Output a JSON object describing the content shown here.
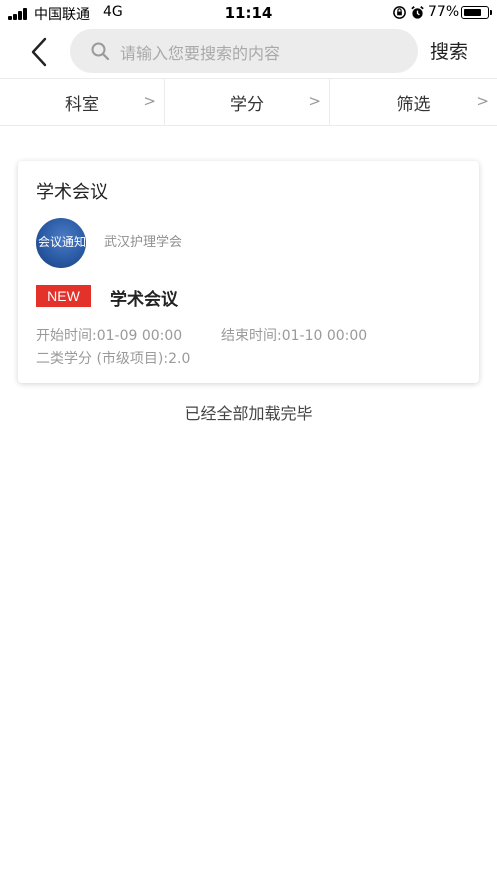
{
  "status_bar": {
    "carrier": "中国联通",
    "network": "4G",
    "time": "11:14",
    "battery_percent": "77%",
    "battery_level": 0.77
  },
  "header": {
    "search_placeholder": "请输入您要搜索的内容",
    "search_button": "搜索"
  },
  "filters": [
    {
      "label": "科室",
      "arrow": ">"
    },
    {
      "label": "学分",
      "arrow": ">"
    },
    {
      "label": "筛选",
      "arrow": ">"
    }
  ],
  "card": {
    "category_title": "学术会议",
    "avatar_text": "会议通知",
    "organizer": "武汉护理学会",
    "badge": "NEW",
    "event_title": "学术会议",
    "start_time": "开始时间:01-09 00:00",
    "end_time": "结束时间:01-10 00:00",
    "credit": "二类学分 (市级项目):2.0"
  },
  "footer_status": "已经全部加载完毕",
  "colors": {
    "badge_red": "#e3322a",
    "search_bg": "#ececec",
    "avatar_blue": "#2a5aa4"
  },
  "icons": {
    "back": "chevron-left-icon",
    "search": "search-icon",
    "alarm": "alarm-icon",
    "lock_rotation": "rotation-lock-icon"
  }
}
